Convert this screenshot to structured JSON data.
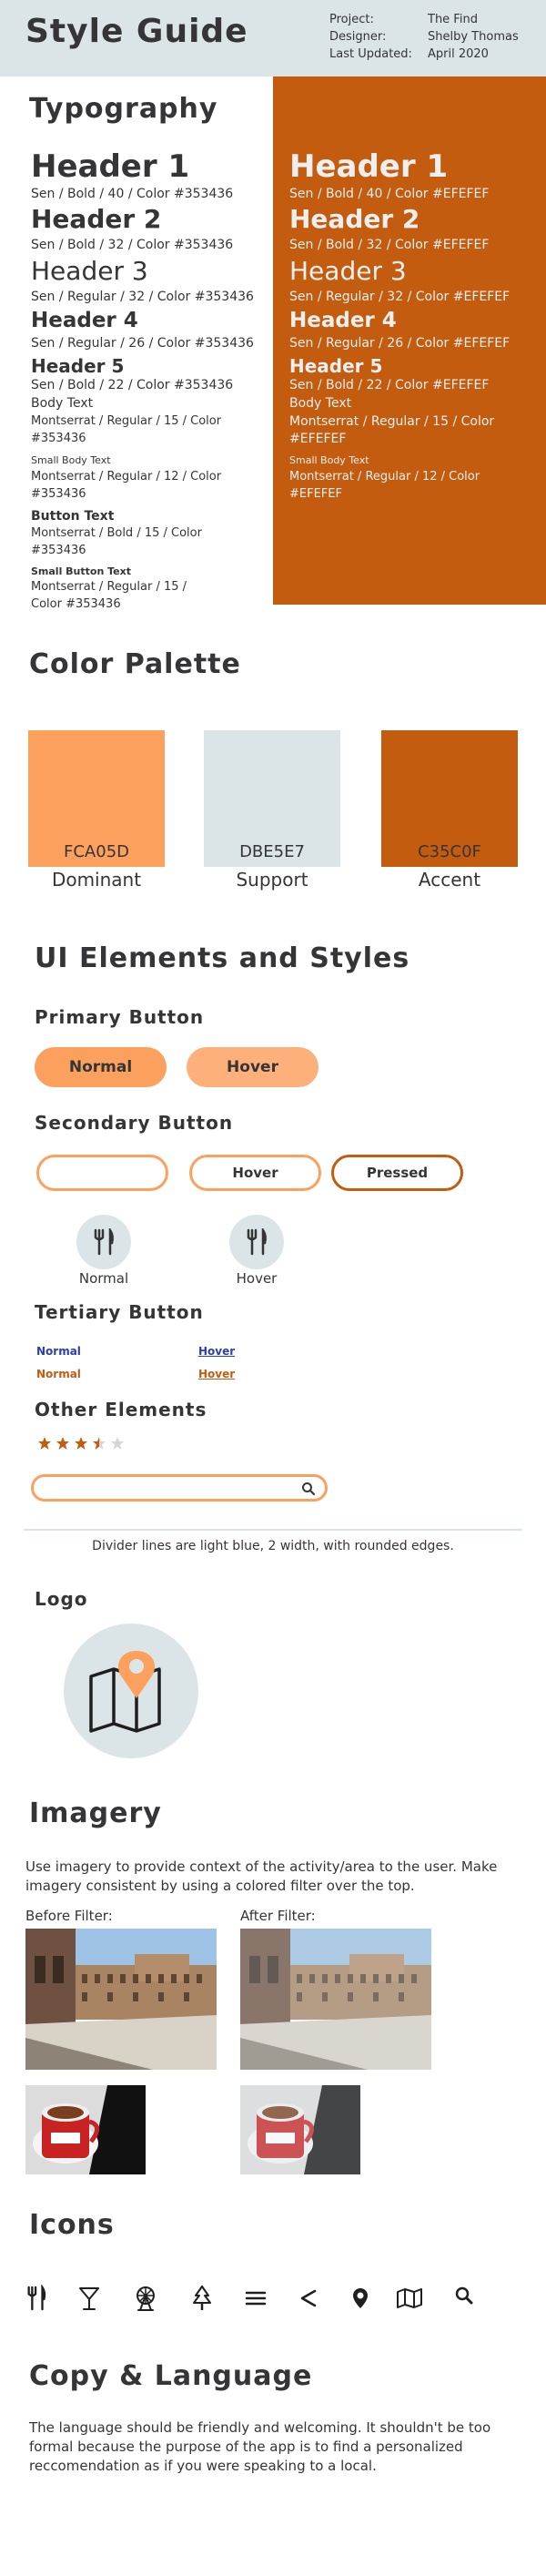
{
  "header": {
    "title": "Style Guide",
    "project_label": "Project:",
    "project_value": "The Find",
    "designer_label": "Designer:",
    "designer_value": "Shelby Thomas",
    "updated_label": "Last Updated:",
    "updated_value": "April 2020"
  },
  "typography": {
    "title": "Typography",
    "dark": [
      {
        "sample": "Header 1",
        "spec": "Sen / Bold / 40 / Color #353436"
      },
      {
        "sample": "Header 2",
        "spec": "Sen / Bold / 32 / Color #353436"
      },
      {
        "sample": "Header 3",
        "spec": "Sen / Regular / 32 / Color #353436"
      },
      {
        "sample": "Header 4",
        "spec": "Sen / Regular / 26 / Color #353436"
      },
      {
        "sample": "Header 5",
        "spec": "Sen / Bold / 22 / Color #353436"
      },
      {
        "sample": "Body Text",
        "spec1": "Montserrat / Regular / 15 / Color",
        "spec2": "#353436"
      },
      {
        "sample": "Small Body Text",
        "spec1": "Montserrat / Regular / 12 / Color",
        "spec2": "#353436"
      },
      {
        "sample": "Button Text",
        "spec1": "Montserrat / Bold / 15 / Color",
        "spec2": "#353436"
      },
      {
        "sample": "Small Button Text",
        "spec1": "Montserrat / Regular  / 15 /",
        "spec2": "Color #353436"
      }
    ],
    "light": [
      {
        "sample": "Header 1",
        "spec": "Sen / Bold / 40 / Color #EFEFEF"
      },
      {
        "sample": "Header 2",
        "spec": "Sen / Bold / 32 / Color #EFEFEF"
      },
      {
        "sample": "Header 3",
        "spec": "Sen / Regular / 32 / Color #EFEFEF"
      },
      {
        "sample": "Header 4",
        "spec": "Sen / Regular / 26 / Color #EFEFEF"
      },
      {
        "sample": "Header 5",
        "spec": "Sen / Bold / 22 / Color #EFEFEF"
      },
      {
        "sample": "Body Text",
        "spec1": "Montserrat / Regular / 15 / Color",
        "spec2": "#EFEFEF"
      },
      {
        "sample": "Small Body Text",
        "spec1": "Montserrat / Regular / 12 / Color",
        "spec2": "#EFEFEF"
      }
    ]
  },
  "palette": {
    "title": "Color Palette",
    "colors": [
      {
        "code": "FCA05D",
        "name": "Dominant",
        "hex": "#fca05d"
      },
      {
        "code": "DBE5E7",
        "name": "Support",
        "hex": "#dbe5e7"
      },
      {
        "code": "C35C0F",
        "name": "Accent",
        "hex": "#c35c0f"
      }
    ]
  },
  "ui": {
    "title": "UI Elements and Styles",
    "primary_title": "Primary Button",
    "primary_normal": "Normal",
    "primary_hover": "Hover",
    "secondary_title": "Secondary Button",
    "secondary_normal": "",
    "secondary_hover": "Hover",
    "secondary_pressed": "Pressed",
    "icon_btn_normal": "Normal",
    "icon_btn_hover": "Hover",
    "tertiary_title": "Tertiary Button",
    "tertiary_normal_1": "Normal",
    "tertiary_hover_1": "Hover",
    "tertiary_normal_2": "Normal",
    "tertiary_hover_2": "Hover",
    "other_title": "Other Elements",
    "rating": 3.5,
    "rating_max": 5,
    "divider_note": "Divider lines are light blue, 2 width, with rounded edges."
  },
  "logo": {
    "title": "Logo"
  },
  "imagery": {
    "title": "Imagery",
    "description": "Use imagery to provide context of the activity/area to the user. Make imagery consistent by using a colored filter over the top.",
    "before_label": "Before Filter:",
    "after_label": "After Filter:"
  },
  "icons": {
    "title": "Icons",
    "list": [
      "fork-knife-icon",
      "cocktail-icon",
      "ferris-wheel-icon",
      "tree-icon",
      "menu-icon",
      "back-chevron-icon",
      "map-pin-icon",
      "map-icon",
      "search-icon"
    ]
  },
  "copy": {
    "title": "Copy & Language",
    "text": "The language should be friendly and welcoming. It shouldn't be too formal because the purpose of the app is to find a personalized reccomendation as if you were speaking to a local."
  },
  "colors": {
    "dominant": "#fca05d",
    "support": "#dbe5e7",
    "accent": "#c35c0f",
    "text_dark": "#353436",
    "text_light": "#efefef",
    "link_blue": "#2a3fb5"
  }
}
